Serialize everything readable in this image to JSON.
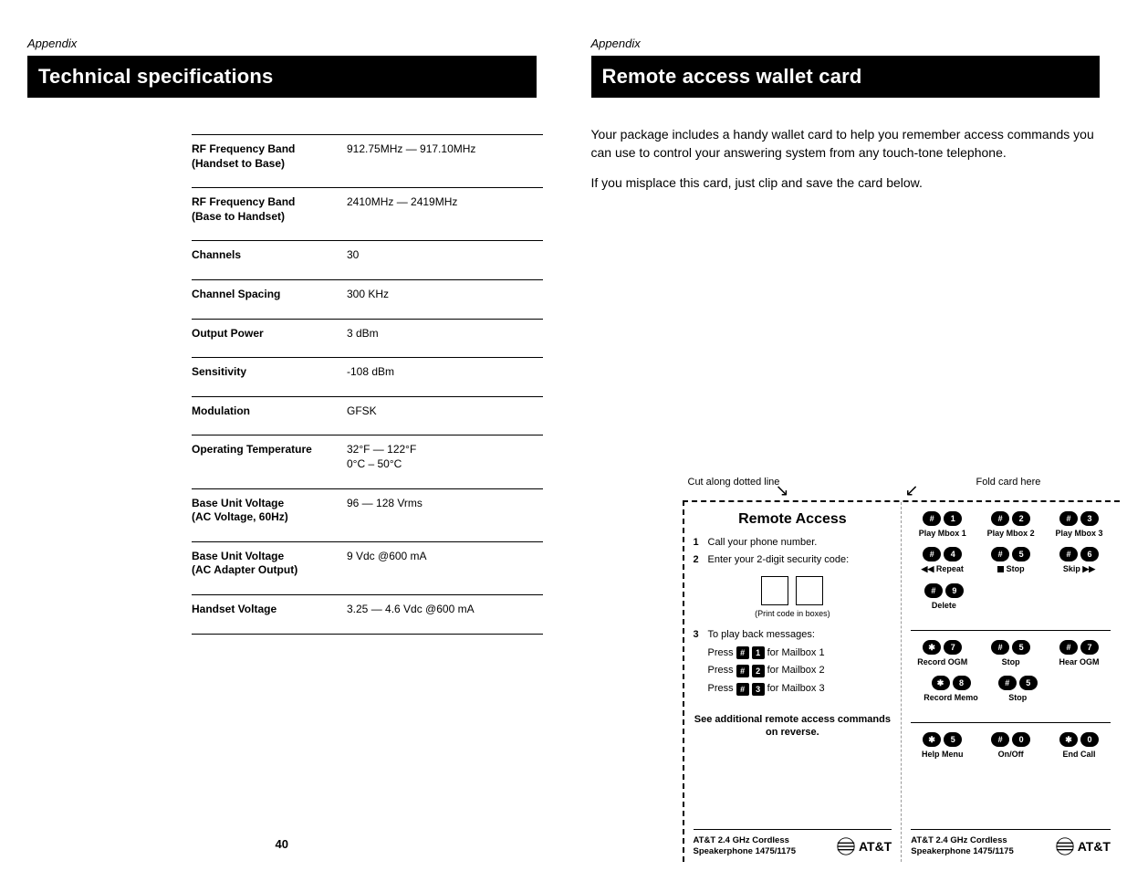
{
  "left": {
    "appendix": "Appendix",
    "heading": "Technical specifications",
    "specs": [
      {
        "label": "RF Frequency Band\n(Handset to Base)",
        "value": "912.75MHz — 917.10MHz"
      },
      {
        "label": "RF Frequency Band\n(Base to Handset)",
        "value": "2410MHz — 2419MHz"
      },
      {
        "label": "Channels",
        "value": "30"
      },
      {
        "label": "Channel Spacing",
        "value": "300 KHz"
      },
      {
        "label": "Output Power",
        "value": "3 dBm"
      },
      {
        "label": "Sensitivity",
        "value": "-108 dBm"
      },
      {
        "label": "Modulation",
        "value": "GFSK"
      },
      {
        "label": "Operating Temperature",
        "value": "32°F — 122°F\n0°C – 50°C"
      },
      {
        "label": "Base Unit Voltage\n(AC Voltage, 60Hz)",
        "value": "96 — 128 Vrms"
      },
      {
        "label": "Base Unit Voltage\n(AC Adapter Output)",
        "value": "9 Vdc @600 mA"
      },
      {
        "label": "Handset Voltage",
        "value": "3.25 — 4.6 Vdc @600 mA"
      }
    ],
    "page_number": "40"
  },
  "right": {
    "appendix": "Appendix",
    "heading": "Remote access wallet card",
    "intro1": "Your package includes a handy wallet card to help you remember access commands you can use to control your answering system from any touch-tone telephone.",
    "intro2": "If you misplace this card, just clip and save the card below.",
    "cut_label": "Cut along dotted line",
    "fold_label": "Fold card here",
    "card": {
      "left": {
        "title": "Remote Access",
        "step1": "Call your phone number.",
        "step2": "Enter your 2-digit security code:",
        "print_hint": "(Print code in boxes)",
        "step3": "To play back messages:",
        "press1_pre": "Press",
        "press1_suf": "for Mailbox 1",
        "press2_pre": "Press",
        "press2_suf": "for Mailbox 2",
        "press3_pre": "Press",
        "press3_suf": "for Mailbox 3",
        "reverse_note": "See additional remote access commands on reverse."
      },
      "right": {
        "row1": [
          {
            "k1": "#",
            "k2": "1",
            "label": "Play Mbox 1"
          },
          {
            "k1": "#",
            "k2": "2",
            "label": "Play Mbox 2"
          },
          {
            "k1": "#",
            "k2": "3",
            "label": "Play Mbox 3"
          }
        ],
        "row2": [
          {
            "k1": "#",
            "k2": "4",
            "label": "◀◀ Repeat"
          },
          {
            "k1": "#",
            "k2": "5",
            "label": "■ Stop"
          },
          {
            "k1": "#",
            "k2": "6",
            "label": "Skip ▶▶"
          }
        ],
        "row3": [
          {
            "k1": "#",
            "k2": "9",
            "label": "Delete"
          }
        ],
        "row4": [
          {
            "k1": "✱",
            "k2": "7",
            "label": "Record OGM"
          },
          {
            "k1": "#",
            "k2": "5",
            "label": "Stop"
          },
          {
            "k1": "#",
            "k2": "7",
            "label": "Hear OGM"
          }
        ],
        "row5": [
          {
            "k1": "✱",
            "k2": "8",
            "label": "Record Memo"
          },
          {
            "k1": "#",
            "k2": "5",
            "label": "Stop"
          }
        ],
        "row6": [
          {
            "k1": "✱",
            "k2": "5",
            "label": "Help Menu"
          },
          {
            "k1": "#",
            "k2": "0",
            "label": "On/Off"
          },
          {
            "k1": "✱",
            "k2": "0",
            "label": "End Call"
          }
        ]
      },
      "footer_text": "AT&T 2.4 GHz Cordless\nSpeakerphone 1475/1175",
      "footer_brand": "AT&T"
    }
  }
}
